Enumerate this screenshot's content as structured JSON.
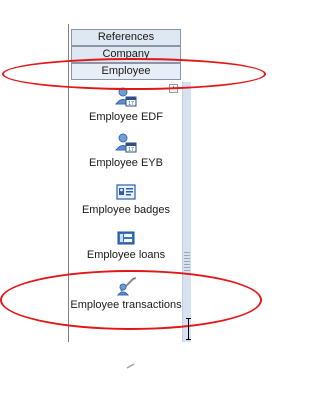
{
  "tabs": {
    "references": "References",
    "company": "Company",
    "employee": "Employee"
  },
  "items": [
    {
      "label": "Employee EDF",
      "icon": "person-calendar-icon"
    },
    {
      "label": "Employee EYB",
      "icon": "person-calendar-icon"
    },
    {
      "label": "Employee badges",
      "icon": "badge-card-icon"
    },
    {
      "label": "Employee loans",
      "icon": "loan-ledger-icon"
    },
    {
      "label": "Employee transactions",
      "icon": "person-pen-icon"
    }
  ],
  "annotation_color": "#e01818"
}
